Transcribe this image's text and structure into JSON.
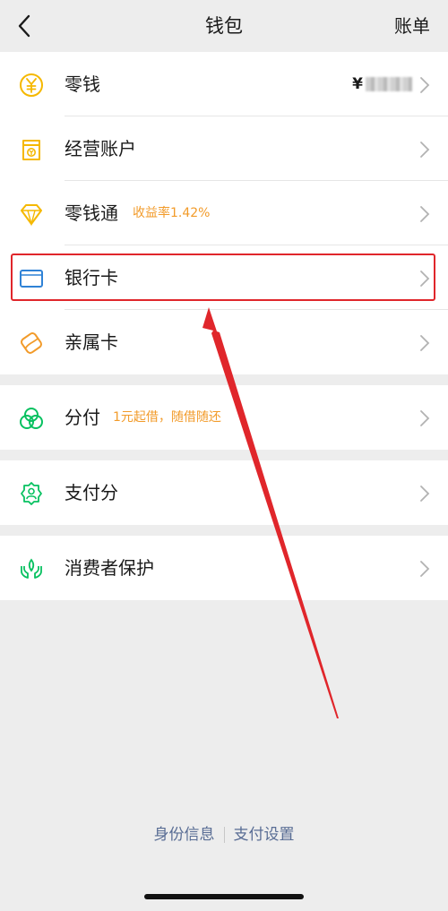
{
  "header": {
    "title": "钱包",
    "bill_label": "账单"
  },
  "group1": {
    "items": [
      {
        "label": "零钱",
        "value_prefix": "¥",
        "icon": "yuan-coin-icon"
      },
      {
        "label": "经营账户",
        "icon": "shop-account-icon"
      },
      {
        "label": "零钱通",
        "tag": "收益率1.42%",
        "icon": "diamond-icon"
      },
      {
        "label": "银行卡",
        "icon": "bank-card-icon"
      },
      {
        "label": "亲属卡",
        "icon": "family-card-icon"
      }
    ]
  },
  "group2": {
    "label": "分付",
    "tag": "1元起借，随借随还",
    "icon": "installment-icon"
  },
  "group3": {
    "label": "支付分",
    "icon": "pay-score-icon"
  },
  "group4": {
    "label": "消费者保护",
    "icon": "consumer-protection-icon"
  },
  "footer": {
    "identity_label": "身份信息",
    "payment_settings_label": "支付设置"
  },
  "colors": {
    "accent_green": "#07c160",
    "accent_yellow": "#f5b800",
    "tag_orange": "#f29b2a",
    "card_blue": "#2f82d6",
    "annotation_red": "#e0262b"
  }
}
